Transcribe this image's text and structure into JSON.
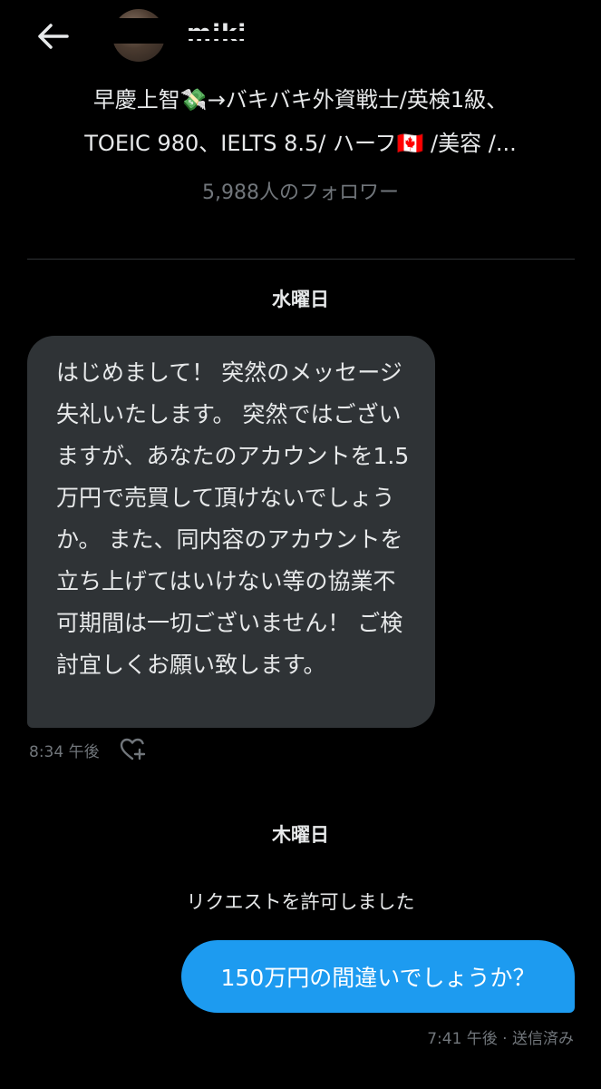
{
  "header": {
    "display_name": "miki",
    "bio_line1": "早慶上智💸→バキバキ外資戦士/英検1級、",
    "bio_line2": "TOEIC 980、IELTS 8.5/ ハーフ🇨🇦 /美容 /...",
    "followers": "5,988人のフォロワー"
  },
  "conversation": {
    "day1_label": "水曜日",
    "incoming_message": "はじめまして！ 突然のメッセージ失礼いたします。 突然ではございますが、あなたのアカウントを1.5万円で売買して頂けないでしょうか。 また、同内容のアカウントを立ち上げてはいけない等の協業不可期間は一切ございません！ ご検討宜しくお願い致します。",
    "incoming_time": "8:34 午後",
    "day2_label": "木曜日",
    "system_message": "リクエストを許可しました",
    "outgoing_message": "150万円の間違いでしょうか？",
    "outgoing_meta": "7:41 午後 · 送信済み"
  },
  "colors": {
    "background": "#000000",
    "incoming_bubble": "#2f3336",
    "outgoing_bubble": "#1d9bf0",
    "muted_text": "#71767b"
  },
  "icons": {
    "back": "back-arrow-icon",
    "react": "heart-plus-icon"
  }
}
